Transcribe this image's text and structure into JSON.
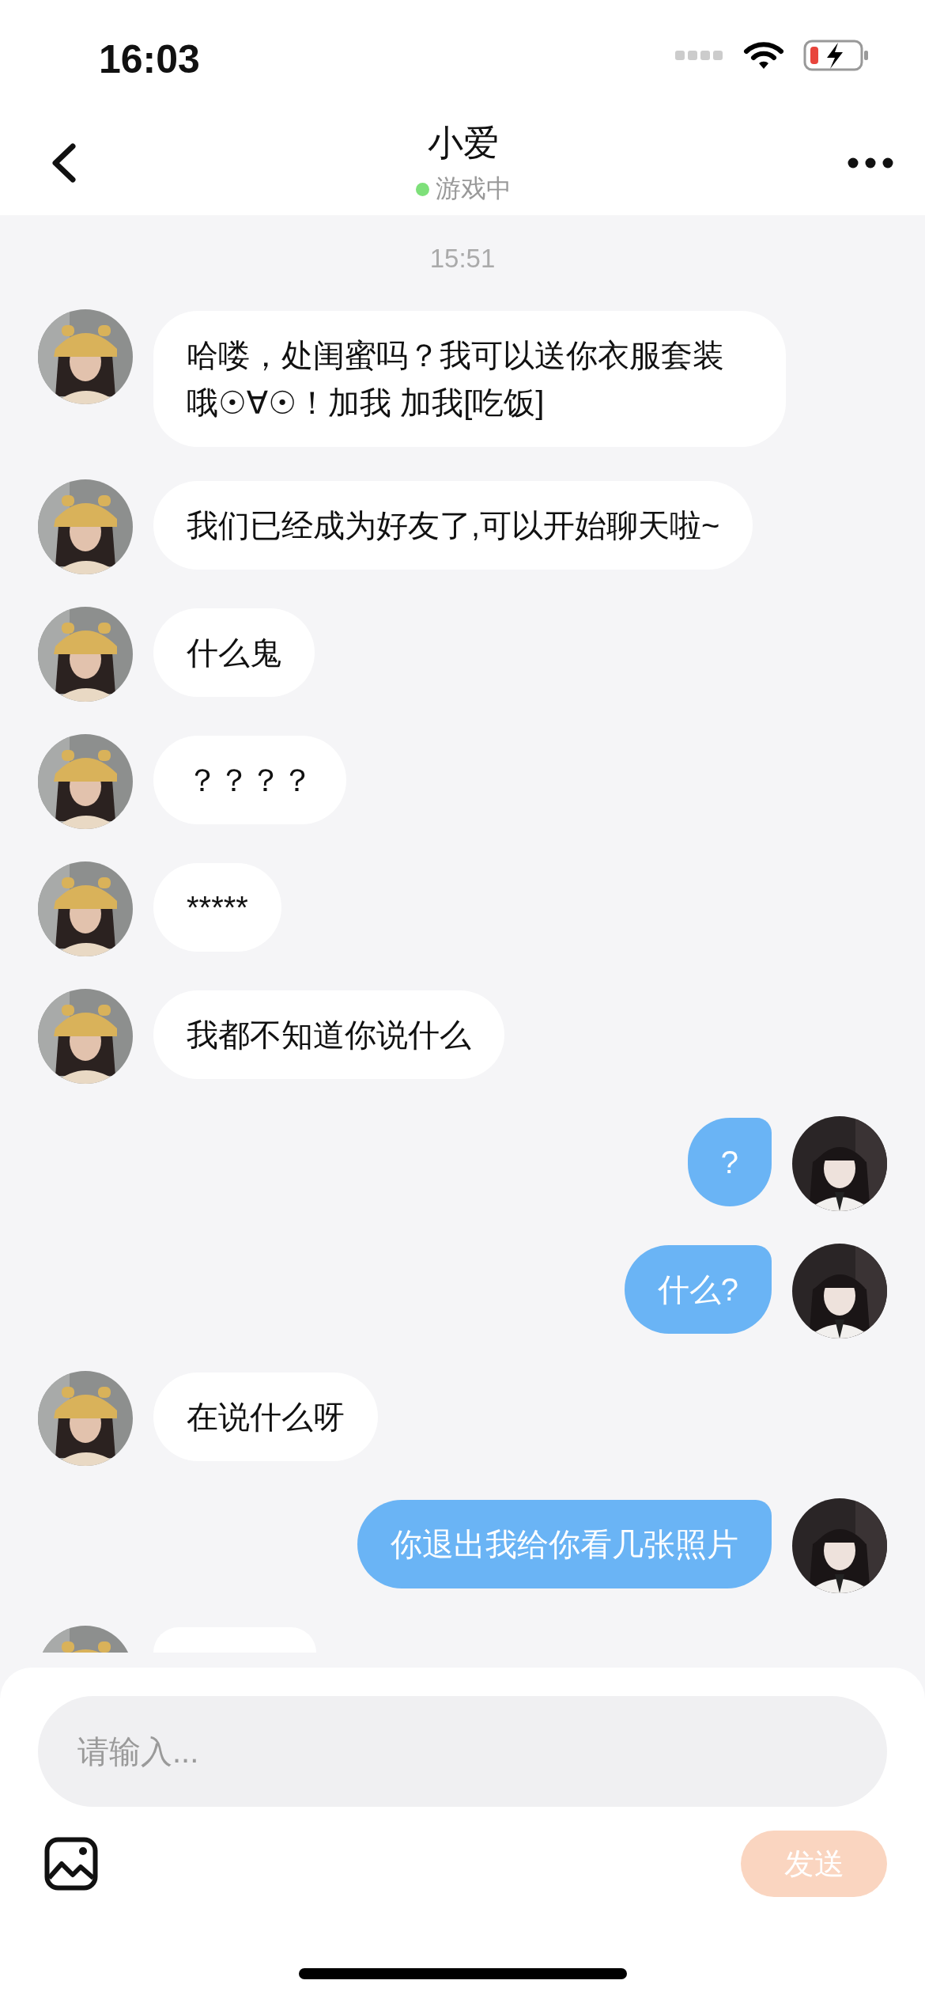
{
  "status_bar": {
    "time": "16:03"
  },
  "header": {
    "title": "小爱",
    "status": {
      "text": "游戏中",
      "online": true
    }
  },
  "timestamp": "15:51",
  "messages": [
    {
      "kind": "text",
      "outgoing": false,
      "text": "哈喽，处闺蜜吗？我可以送你衣服套装哦☉∀☉！加我 加我[吃饭]"
    },
    {
      "kind": "text",
      "outgoing": false,
      "text": "我们已经成为好友了,可以开始聊天啦~"
    },
    {
      "kind": "text",
      "outgoing": false,
      "text": "什么鬼"
    },
    {
      "kind": "text",
      "outgoing": false,
      "text": "？？？？"
    },
    {
      "kind": "text",
      "outgoing": false,
      "text": "*****"
    },
    {
      "kind": "text",
      "outgoing": false,
      "text": "我都不知道你说什么"
    },
    {
      "kind": "text",
      "outgoing": true,
      "text": "?"
    },
    {
      "kind": "text",
      "outgoing": true,
      "text": "什么?"
    },
    {
      "kind": "text",
      "outgoing": false,
      "text": "在说什么呀"
    },
    {
      "kind": "text",
      "outgoing": true,
      "text": "你退出我给你看几张照片"
    },
    {
      "kind": "clipped",
      "outgoing": false
    }
  ],
  "composer": {
    "placeholder": "请输入...",
    "send": {
      "label": "发送",
      "disabled": true
    }
  }
}
